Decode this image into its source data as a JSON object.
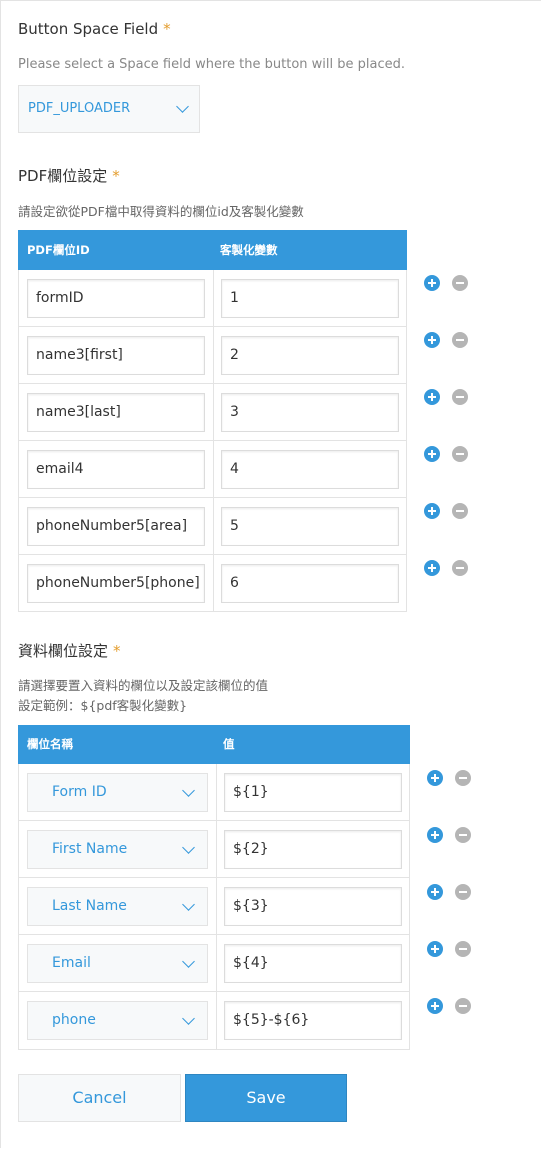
{
  "button_space": {
    "label": "Button Space Field",
    "required_mark": "*",
    "description": "Please select a Space field where the button will be placed.",
    "selected": "PDF_UPLOADER"
  },
  "pdf_fields": {
    "label": "PDF欄位設定",
    "required_mark": "*",
    "description": "請設定欲從PDF檔中取得資料的欄位id及客製化變數",
    "col_field_id": "PDF欄位ID",
    "col_variable": "客製化變數",
    "rows": [
      {
        "field_id": "formID",
        "variable": "1"
      },
      {
        "field_id": "name3[first]",
        "variable": "2"
      },
      {
        "field_id": "name3[last]",
        "variable": "3"
      },
      {
        "field_id": "email4",
        "variable": "4"
      },
      {
        "field_id": "phoneNumber5[area]",
        "variable": "5"
      },
      {
        "field_id": "phoneNumber5[phone]",
        "variable": "6"
      }
    ]
  },
  "data_fields": {
    "label": "資料欄位設定",
    "required_mark": "*",
    "description_line1": "請選擇要置入資料的欄位以及設定該欄位的值",
    "description_line2": "設定範例：${pdf客製化變數}",
    "col_field_name": "欄位名稱",
    "col_value": "值",
    "rows": [
      {
        "field": "Form ID",
        "value": "${1}"
      },
      {
        "field": "First Name",
        "value": "${2}"
      },
      {
        "field": "Last Name",
        "value": "${3}"
      },
      {
        "field": "Email",
        "value": "${4}"
      },
      {
        "field": "phone",
        "value": "${5}-${6}"
      }
    ]
  },
  "actions": {
    "cancel_label": "Cancel",
    "save_label": "Save"
  },
  "colors": {
    "accent": "#3498db",
    "required": "#e49d2e",
    "remove_button": "#b5b5b5",
    "border": "#e3e3e3"
  },
  "icons": {
    "add": "plus-circle-icon",
    "remove": "minus-circle-icon",
    "dropdown": "chevron-down-icon"
  }
}
